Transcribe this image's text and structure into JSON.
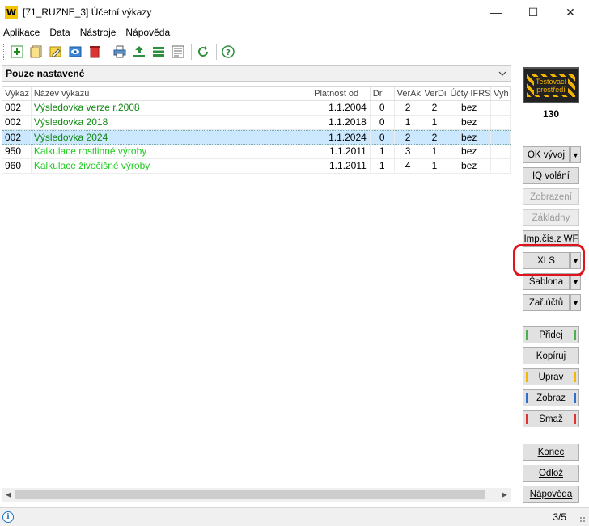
{
  "window": {
    "title": "[71_RUZNE_3] Účetní výkazy",
    "logo_letter": "W",
    "minimize": "—",
    "maximize": "☐",
    "close": "✕"
  },
  "menu": [
    {
      "label": "Aplikace"
    },
    {
      "label": "Data"
    },
    {
      "label": "Nástroje"
    },
    {
      "label": "Nápověda"
    }
  ],
  "filter": {
    "selected": "Pouze nastavené"
  },
  "table": {
    "columns": [
      "Výkaz",
      "Název výkazu",
      "Platnost od",
      "Dr",
      "VerAk",
      "VerDi",
      "Účty IFRS",
      "Vyh"
    ],
    "rows": [
      {
        "code": "002",
        "name": "Výsledovka verze r.2008",
        "valid_from": "1.1.2004",
        "dr": "0",
        "ver_ak": "2",
        "ver_di": "2",
        "ifrs": "bez",
        "tone": "dark"
      },
      {
        "code": "002",
        "name": "Výsledovka 2018",
        "valid_from": "1.1.2018",
        "dr": "0",
        "ver_ak": "1",
        "ver_di": "1",
        "ifrs": "bez",
        "tone": "dark"
      },
      {
        "code": "002",
        "name": "Výsledovka 2024",
        "valid_from": "1.1.2024",
        "dr": "0",
        "ver_ak": "2",
        "ver_di": "2",
        "ifrs": "bez",
        "tone": "dark",
        "selected": true
      },
      {
        "code": "950",
        "name": "Kalkulace rostlinné výroby",
        "valid_from": "1.1.2011",
        "dr": "1",
        "ver_ak": "3",
        "ver_di": "1",
        "ifrs": "bez",
        "tone": "light"
      },
      {
        "code": "960",
        "name": "Kalkulace živočišné výroby",
        "valid_from": "1.1.2011",
        "dr": "1",
        "ver_ak": "4",
        "ver_di": "1",
        "ifrs": "bez",
        "tone": "light"
      }
    ]
  },
  "side": {
    "badge_line1": "Testovací",
    "badge_line2": "prostředí",
    "count": "130",
    "ok_vyvoj": "OK vývoj",
    "iq_volani": "IQ volání",
    "zobrazeni": "Zobrazení",
    "zakladny": "Základny",
    "imp_cis": "Imp.čís.z WF",
    "xls": "XLS",
    "sablona": "Šablona",
    "zar_uctu": "Zař.účtů",
    "pridej": "Přidej",
    "kopiruj": "Kopíruj",
    "uprav": "Uprav",
    "zobraz": "Zobraz",
    "smaz": "Smaž",
    "konec": "Konec",
    "odloz": "Odlož",
    "napoveda": "Nápověda",
    "dropdown_arrow": "▼"
  },
  "status": {
    "info": "i",
    "page": "3/5"
  },
  "colors": {
    "selected_row": "#cce8ff",
    "highlight_ring": "#e0141e",
    "green_dark": "#118811",
    "green_light": "#22cc22",
    "bar_green": "#4caf50",
    "bar_yellow": "#f2b705",
    "bar_blue": "#2f6fcf",
    "bar_red": "#d33"
  }
}
